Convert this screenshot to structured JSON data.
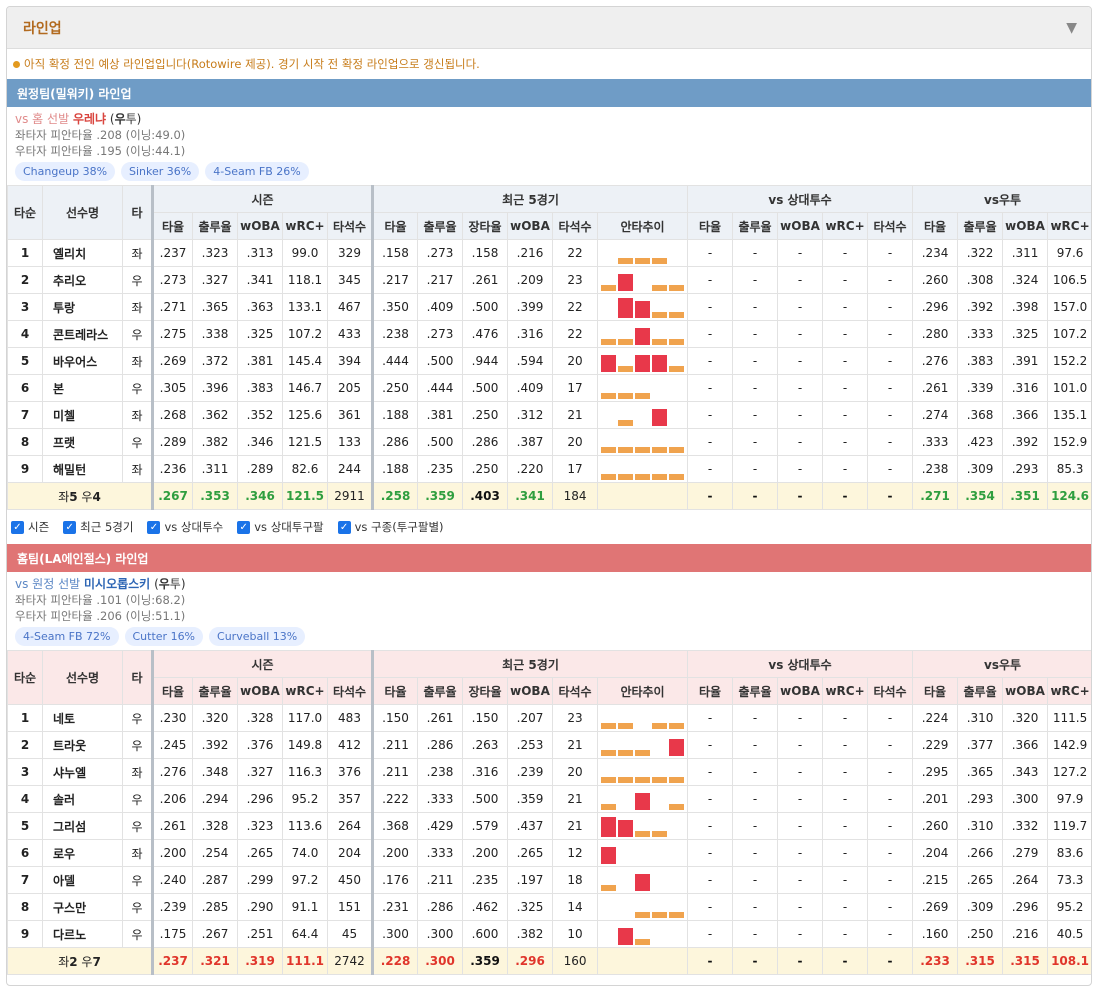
{
  "panel": {
    "title": "라인업",
    "collapse_icon": "▼"
  },
  "notice": "아직 확정 전인 예상 라인업입니다(Rotowire 제공). 경기 시작 전 확정 라인업으로 갱신됩니다.",
  "headers": {
    "order": "타순",
    "name": "선수명",
    "hand": "타",
    "groups": [
      "시즌",
      "최근 5경기",
      "vs 상대투수",
      "vs우투"
    ],
    "season_cols": [
      "타율",
      "출루율",
      "wOBA",
      "wRC+",
      "타석수"
    ],
    "recent_cols": [
      "타율",
      "출루율",
      "장타율",
      "wOBA",
      "타석수",
      "안타추이"
    ],
    "vsp_cols": [
      "타율",
      "출루율",
      "wOBA",
      "wRC+",
      "타석수"
    ],
    "vsh_cols": [
      "타율",
      "출루율",
      "wOBA",
      "wRC+"
    ]
  },
  "checkboxes": [
    "시즌",
    "최근 5경기",
    "vs 상대투수",
    "vs 상대투구팔",
    "vs 구종(투구팔별)"
  ],
  "away": {
    "bar_title": "원정팀(밀워키) 라인업",
    "vs_prefix": "vs 홈 선발",
    "pitcher": "우레냐",
    "hand_open": "(",
    "hand_letter": "우",
    "hand_close": "투)",
    "lhb": "좌타자 피안타율 .208 (이닝:49.0)",
    "rhb": "우타자 피안타율 .195 (이닝:44.1)",
    "tags": [
      "Changeup 38%",
      "Sinker 36%",
      "4-Seam FB 26%"
    ],
    "rows": [
      {
        "order": "1",
        "name": "옐리치",
        "hand": "좌",
        "s": [
          ".237",
          ".323",
          ".313",
          "99.0",
          "329"
        ],
        "r": [
          ".158",
          ".273",
          ".158",
          ".216",
          "22"
        ],
        "spark": [
          0,
          1,
          1,
          1,
          0
        ],
        "p": [
          "-",
          "-",
          "-",
          "-",
          "-"
        ],
        "v": [
          ".234",
          ".322",
          ".311",
          "97.6"
        ]
      },
      {
        "order": "2",
        "name": "추리오",
        "hand": "우",
        "s": [
          ".273",
          ".327",
          ".341",
          "118.1",
          "345"
        ],
        "r": [
          ".217",
          ".217",
          ".261",
          ".209",
          "23"
        ],
        "spark": [
          1,
          2,
          0,
          1,
          1
        ],
        "p": [
          "-",
          "-",
          "-",
          "-",
          "-"
        ],
        "v": [
          ".260",
          ".308",
          ".324",
          "106.5"
        ]
      },
      {
        "order": "3",
        "name": "투랑",
        "hand": "좌",
        "s": [
          ".271",
          ".365",
          ".363",
          "133.1",
          "467"
        ],
        "r": [
          ".350",
          ".409",
          ".500",
          ".399",
          "22"
        ],
        "spark": [
          0,
          3,
          2,
          1,
          1
        ],
        "p": [
          "-",
          "-",
          "-",
          "-",
          "-"
        ],
        "v": [
          ".296",
          ".392",
          ".398",
          "157.0"
        ]
      },
      {
        "order": "4",
        "name": "콘트레라스",
        "hand": "우",
        "s": [
          ".275",
          ".338",
          ".325",
          "107.2",
          "433"
        ],
        "r": [
          ".238",
          ".273",
          ".476",
          ".316",
          "22"
        ],
        "spark": [
          1,
          1,
          2,
          1,
          1
        ],
        "p": [
          "-",
          "-",
          "-",
          "-",
          "-"
        ],
        "v": [
          ".280",
          ".333",
          ".325",
          "107.2"
        ]
      },
      {
        "order": "5",
        "name": "바우어스",
        "hand": "좌",
        "s": [
          ".269",
          ".372",
          ".381",
          "145.4",
          "394"
        ],
        "r": [
          ".444",
          ".500",
          ".944",
          ".594",
          "20"
        ],
        "spark": [
          2,
          1,
          2,
          2,
          1
        ],
        "p": [
          "-",
          "-",
          "-",
          "-",
          "-"
        ],
        "v": [
          ".276",
          ".383",
          ".391",
          "152.2"
        ]
      },
      {
        "order": "6",
        "name": "본",
        "hand": "우",
        "s": [
          ".305",
          ".396",
          ".383",
          "146.7",
          "205"
        ],
        "r": [
          ".250",
          ".444",
          ".500",
          ".409",
          "17"
        ],
        "spark": [
          1,
          1,
          1,
          0,
          0
        ],
        "p": [
          "-",
          "-",
          "-",
          "-",
          "-"
        ],
        "v": [
          ".261",
          ".339",
          ".316",
          "101.0"
        ]
      },
      {
        "order": "7",
        "name": "미첼",
        "hand": "좌",
        "s": [
          ".268",
          ".362",
          ".352",
          "125.6",
          "361"
        ],
        "r": [
          ".188",
          ".381",
          ".250",
          ".312",
          "21"
        ],
        "spark": [
          0,
          1,
          0,
          2,
          0
        ],
        "p": [
          "-",
          "-",
          "-",
          "-",
          "-"
        ],
        "v": [
          ".274",
          ".368",
          ".366",
          "135.1"
        ]
      },
      {
        "order": "8",
        "name": "프랫",
        "hand": "우",
        "s": [
          ".289",
          ".382",
          ".346",
          "121.5",
          "133"
        ],
        "r": [
          ".286",
          ".500",
          ".286",
          ".387",
          "20"
        ],
        "spark": [
          1,
          1,
          1,
          1,
          1
        ],
        "p": [
          "-",
          "-",
          "-",
          "-",
          "-"
        ],
        "v": [
          ".333",
          ".423",
          ".392",
          "152.9"
        ]
      },
      {
        "order": "9",
        "name": "해밀턴",
        "hand": "좌",
        "s": [
          ".236",
          ".311",
          ".289",
          "82.6",
          "244"
        ],
        "r": [
          ".188",
          ".235",
          ".250",
          ".220",
          "17"
        ],
        "spark": [
          1,
          1,
          1,
          1,
          1
        ],
        "p": [
          "-",
          "-",
          "-",
          "-",
          "-"
        ],
        "v": [
          ".238",
          ".309",
          ".293",
          "85.3"
        ]
      }
    ],
    "summary": {
      "label_pre": "좌",
      "left_count": "5",
      "label_mid": " 우",
      "right_count": "4",
      "s": [
        ".267",
        ".353",
        ".346",
        "121.5",
        "2911"
      ],
      "r": [
        ".258",
        ".359",
        ".403",
        ".341",
        "184"
      ],
      "p": [
        "-",
        "-",
        "-",
        "-",
        "-"
      ],
      "v": [
        ".271",
        ".354",
        ".351",
        "124.6"
      ]
    }
  },
  "home": {
    "bar_title": "홈팀(LA에인절스) 라인업",
    "vs_prefix": "vs 원정 선발",
    "pitcher": "미시오롭스키",
    "hand_open": "(",
    "hand_letter": "우",
    "hand_close": "투)",
    "lhb": "좌타자 피안타율 .101 (이닝:68.2)",
    "rhb": "우타자 피안타율 .206 (이닝:51.1)",
    "tags": [
      "4-Seam FB 72%",
      "Cutter 16%",
      "Curveball 13%"
    ],
    "rows": [
      {
        "order": "1",
        "name": "네토",
        "hand": "우",
        "s": [
          ".230",
          ".320",
          ".328",
          "117.0",
          "483"
        ],
        "r": [
          ".150",
          ".261",
          ".150",
          ".207",
          "23"
        ],
        "spark": [
          1,
          1,
          0,
          1,
          1
        ],
        "p": [
          "-",
          "-",
          "-",
          "-",
          "-"
        ],
        "v": [
          ".224",
          ".310",
          ".320",
          "111.5"
        ]
      },
      {
        "order": "2",
        "name": "트라웃",
        "hand": "우",
        "s": [
          ".245",
          ".392",
          ".376",
          "149.8",
          "412"
        ],
        "r": [
          ".211",
          ".286",
          ".263",
          ".253",
          "21"
        ],
        "spark": [
          1,
          1,
          1,
          0,
          2
        ],
        "p": [
          "-",
          "-",
          "-",
          "-",
          "-"
        ],
        "v": [
          ".229",
          ".377",
          ".366",
          "142.9"
        ]
      },
      {
        "order": "3",
        "name": "샤누엘",
        "hand": "좌",
        "s": [
          ".276",
          ".348",
          ".327",
          "116.3",
          "376"
        ],
        "r": [
          ".211",
          ".238",
          ".316",
          ".239",
          "20"
        ],
        "spark": [
          1,
          1,
          1,
          1,
          1
        ],
        "p": [
          "-",
          "-",
          "-",
          "-",
          "-"
        ],
        "v": [
          ".295",
          ".365",
          ".343",
          "127.2"
        ]
      },
      {
        "order": "4",
        "name": "솔러",
        "hand": "우",
        "s": [
          ".206",
          ".294",
          ".296",
          "95.2",
          "357"
        ],
        "r": [
          ".222",
          ".333",
          ".500",
          ".359",
          "21"
        ],
        "spark": [
          1,
          0,
          2,
          0,
          1
        ],
        "p": [
          "-",
          "-",
          "-",
          "-",
          "-"
        ],
        "v": [
          ".201",
          ".293",
          ".300",
          "97.9"
        ]
      },
      {
        "order": "5",
        "name": "그리섬",
        "hand": "우",
        "s": [
          ".261",
          ".328",
          ".323",
          "113.6",
          "264"
        ],
        "r": [
          ".368",
          ".429",
          ".579",
          ".437",
          "21"
        ],
        "spark": [
          3,
          2,
          1,
          1,
          0
        ],
        "p": [
          "-",
          "-",
          "-",
          "-",
          "-"
        ],
        "v": [
          ".260",
          ".310",
          ".332",
          "119.7"
        ]
      },
      {
        "order": "6",
        "name": "로우",
        "hand": "좌",
        "s": [
          ".200",
          ".254",
          ".265",
          "74.0",
          "204"
        ],
        "r": [
          ".200",
          ".333",
          ".200",
          ".265",
          "12"
        ],
        "spark": [
          2,
          0,
          0,
          0,
          0
        ],
        "p": [
          "-",
          "-",
          "-",
          "-",
          "-"
        ],
        "v": [
          ".204",
          ".266",
          ".279",
          "83.6"
        ]
      },
      {
        "order": "7",
        "name": "아델",
        "hand": "우",
        "s": [
          ".240",
          ".287",
          ".299",
          "97.2",
          "450"
        ],
        "r": [
          ".176",
          ".211",
          ".235",
          ".197",
          "18"
        ],
        "spark": [
          1,
          0,
          2,
          0,
          0
        ],
        "p": [
          "-",
          "-",
          "-",
          "-",
          "-"
        ],
        "v": [
          ".215",
          ".265",
          ".264",
          "73.3"
        ]
      },
      {
        "order": "8",
        "name": "구스만",
        "hand": "우",
        "s": [
          ".239",
          ".285",
          ".290",
          "91.1",
          "151"
        ],
        "r": [
          ".231",
          ".286",
          ".462",
          ".325",
          "14"
        ],
        "spark": [
          0,
          0,
          1,
          1,
          1
        ],
        "p": [
          "-",
          "-",
          "-",
          "-",
          "-"
        ],
        "v": [
          ".269",
          ".309",
          ".296",
          "95.2"
        ]
      },
      {
        "order": "9",
        "name": "다르노",
        "hand": "우",
        "s": [
          ".175",
          ".267",
          ".251",
          "64.4",
          "45"
        ],
        "r": [
          ".300",
          ".300",
          ".600",
          ".382",
          "10"
        ],
        "spark": [
          0,
          2,
          1,
          0,
          0
        ],
        "p": [
          "-",
          "-",
          "-",
          "-",
          "-"
        ],
        "v": [
          ".160",
          ".250",
          ".216",
          "40.5"
        ]
      }
    ],
    "summary": {
      "label_pre": "좌",
      "left_count": "2",
      "label_mid": " 우",
      "right_count": "7",
      "s": [
        ".237",
        ".321",
        ".319",
        "111.1",
        "2742"
      ],
      "r": [
        ".228",
        ".300",
        ".359",
        ".296",
        "160"
      ],
      "p": [
        "-",
        "-",
        "-",
        "-",
        "-"
      ],
      "v": [
        ".233",
        ".315",
        ".315",
        "108.1"
      ]
    }
  }
}
